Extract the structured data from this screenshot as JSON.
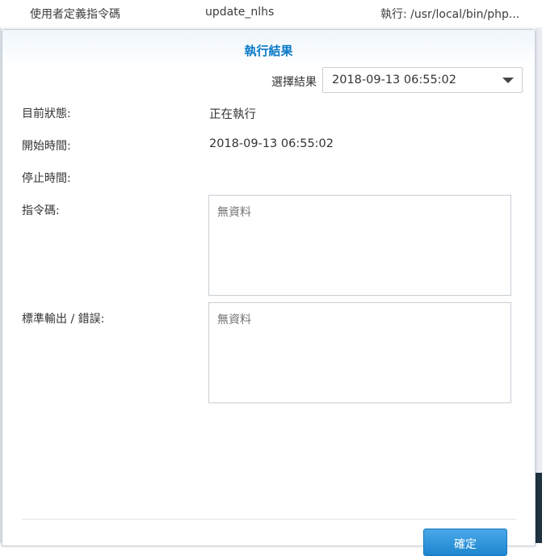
{
  "background_row": {
    "type": "使用者定義指令碼",
    "name": "update_nlhs",
    "command": "執行: /usr/local/bin/php..."
  },
  "dialog": {
    "title": "執行結果",
    "select_label": "選擇結果",
    "select_value": "2018-09-13 06:55:02",
    "status_label": "目前狀態:",
    "status_value": "正在執行",
    "start_label": "開始時間:",
    "start_value": "2018-09-13 06:55:02",
    "stop_label": "停止時間:",
    "stop_value": "",
    "command_label": "指令碼:",
    "command_placeholder": "無資料",
    "output_label": "標準輸出 / 錯誤:",
    "output_placeholder": "無資料",
    "ok_label": "確定"
  },
  "colors": {
    "title": "#0a7ac7",
    "button": "#1d86d0"
  }
}
